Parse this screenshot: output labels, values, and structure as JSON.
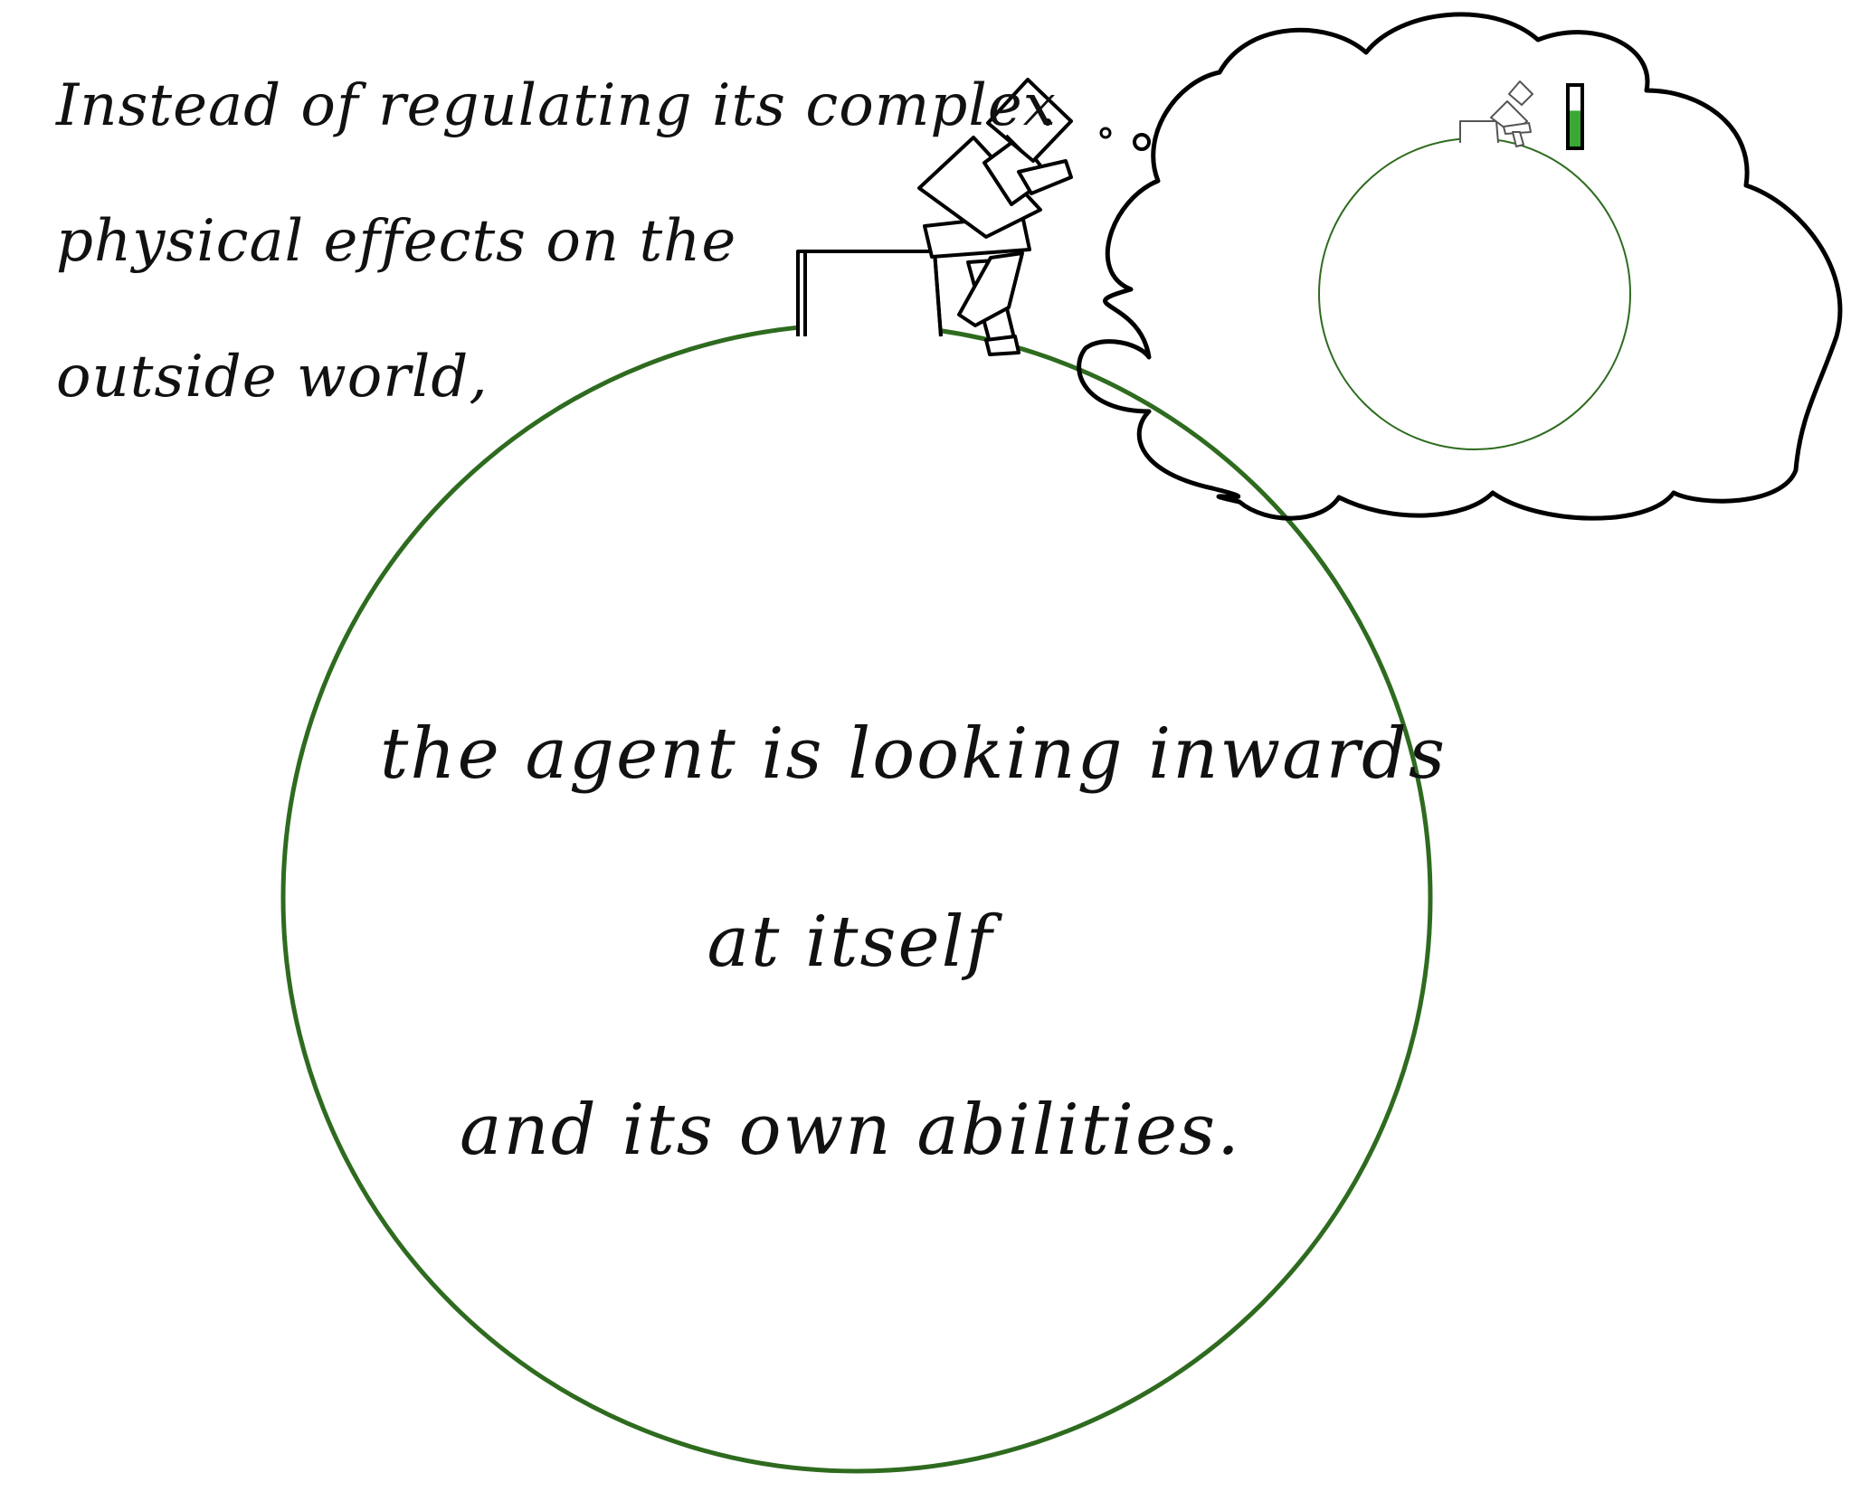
{
  "caption": {
    "line1": "Instead of regulating its complex",
    "line2": "physical effects on the",
    "line3": "outside world,"
  },
  "planet_text": {
    "line1": "the agent is looking inwards",
    "line2": "at itself",
    "line3": "and its own abilities."
  },
  "colors": {
    "planet_outline": "#2e6b1f",
    "meter_fill": "#3aa834",
    "ink": "#000000"
  },
  "thought_bubble": {
    "meter_level": 0.6
  }
}
